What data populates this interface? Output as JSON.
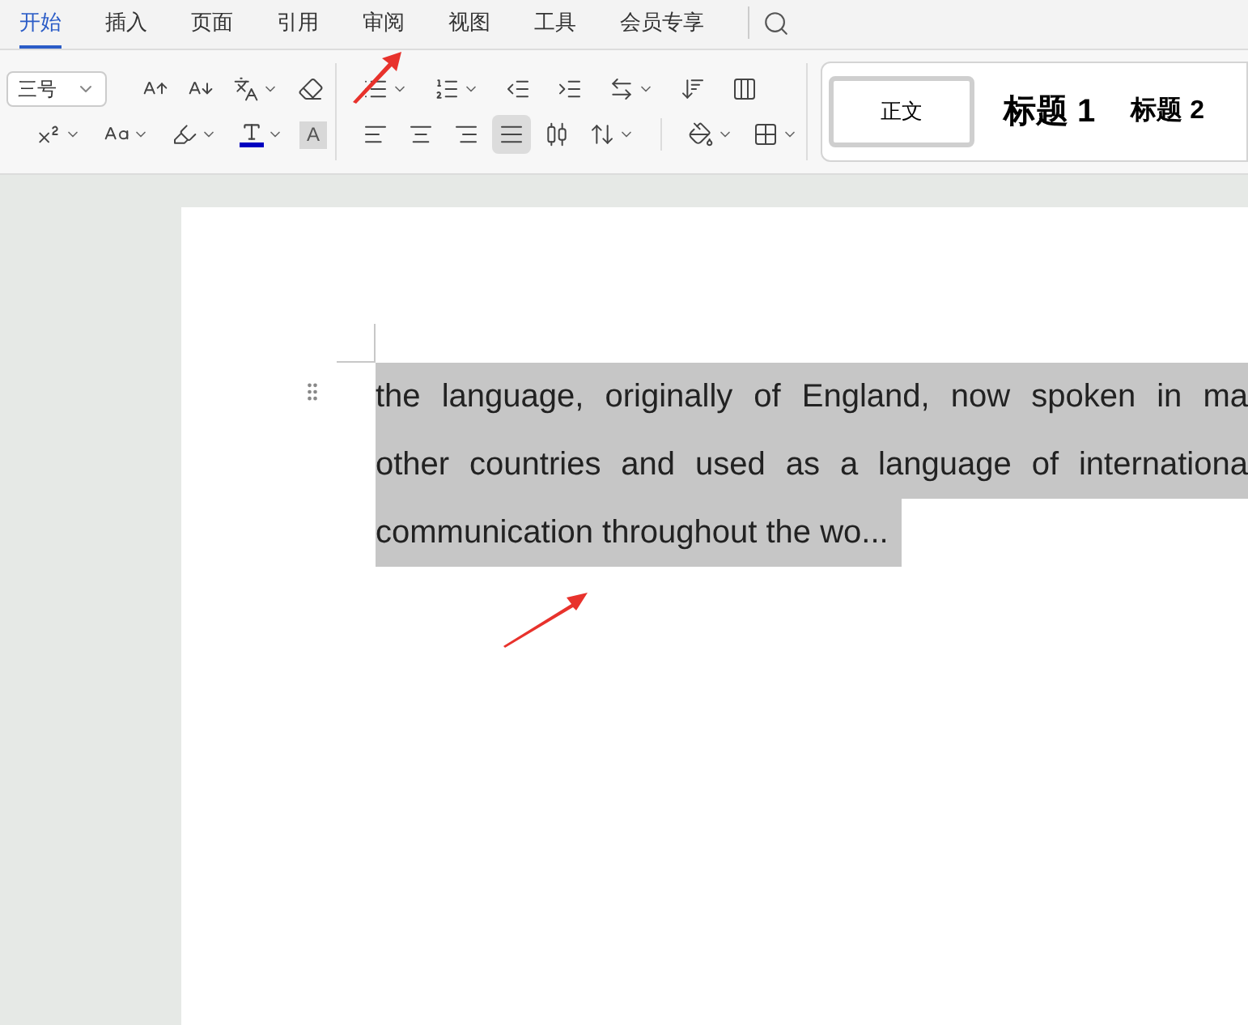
{
  "tabs": [
    {
      "label": "开始",
      "selected": true
    },
    {
      "label": "插入",
      "selected": false
    },
    {
      "label": "页面",
      "selected": false
    },
    {
      "label": "引用",
      "selected": false
    },
    {
      "label": "审阅",
      "selected": false
    },
    {
      "label": "视图",
      "selected": false
    },
    {
      "label": "工具",
      "selected": false
    },
    {
      "label": "会员专享",
      "selected": false
    }
  ],
  "ribbon": {
    "font_size": "三号",
    "shading_label": "A",
    "alignments": [
      {
        "kind": "left",
        "selected": false
      },
      {
        "kind": "center",
        "selected": false
      },
      {
        "kind": "right",
        "selected": false
      },
      {
        "kind": "justify",
        "selected": true
      },
      {
        "kind": "distributed",
        "selected": false
      }
    ]
  },
  "styles": [
    {
      "kind": "body",
      "label": "正文",
      "selected": true
    },
    {
      "kind": "heading1",
      "label": "标题 1",
      "selected": false
    },
    {
      "kind": "heading2",
      "label": "标题 2",
      "selected": false
    }
  ],
  "document": {
    "lines": [
      {
        "text": "the language, originally of England, now spoken in ma",
        "selected": true,
        "justified": true
      },
      {
        "text": "other countries and used as a language of internationa",
        "selected": true,
        "justified": true
      },
      {
        "text": "communication throughout the wo...",
        "selected": true,
        "justified": false
      }
    ]
  }
}
